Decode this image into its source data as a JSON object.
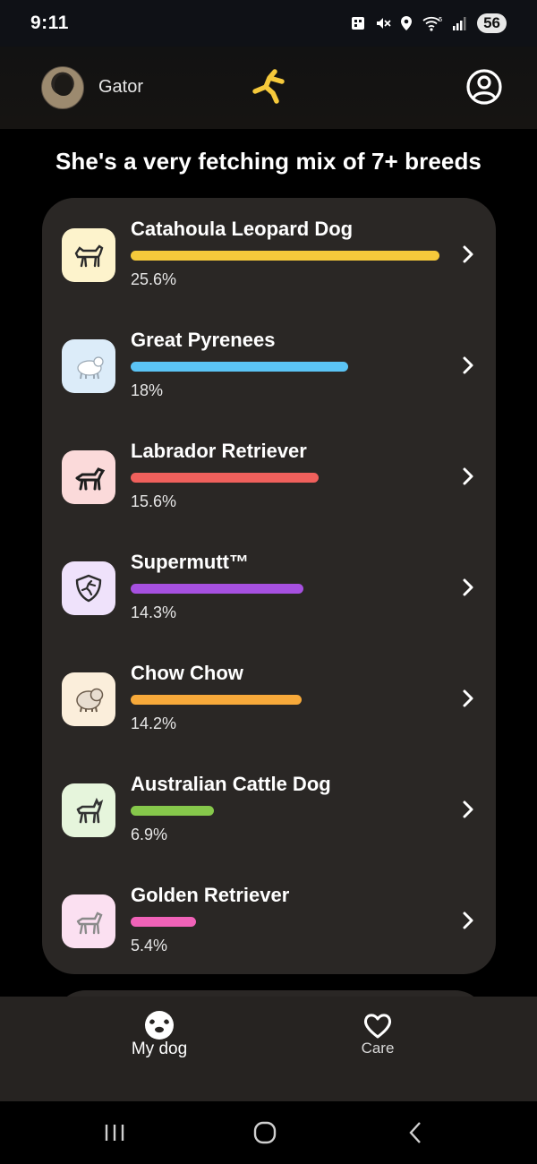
{
  "status_bar": {
    "time": "9:11",
    "battery": "56",
    "network": "5"
  },
  "header": {
    "dog_name": "Gator"
  },
  "headline": "She's a very fetching mix of 7+ breeds",
  "breeds": [
    {
      "name": "Catahoula Leopard Dog",
      "percent_label": "25.6%",
      "percent": 25.6,
      "color": "#f5c93b",
      "icon_bg": "#fdf3cc",
      "icon": "catahoula-dog-icon"
    },
    {
      "name": "Great Pyrenees",
      "percent_label": "18%",
      "percent": 18,
      "color": "#5bc4f5",
      "icon_bg": "#dcecf9",
      "icon": "great-pyrenees-icon"
    },
    {
      "name": "Labrador Retriever",
      "percent_label": "15.6%",
      "percent": 15.6,
      "color": "#f0605c",
      "icon_bg": "#fbdada",
      "icon": "labrador-icon"
    },
    {
      "name": "Supermutt™",
      "percent_label": "14.3%",
      "percent": 14.3,
      "color": "#a650e0",
      "icon_bg": "#efe2fb",
      "icon": "supermutt-shield-icon"
    },
    {
      "name": "Chow Chow",
      "percent_label": "14.2%",
      "percent": 14.2,
      "color": "#f7a93a",
      "icon_bg": "#fbeedb",
      "icon": "chow-chow-icon"
    },
    {
      "name": "Australian Cattle Dog",
      "percent_label": "6.9%",
      "percent": 6.9,
      "color": "#86c84b",
      "icon_bg": "#e6f5dc",
      "icon": "cattle-dog-icon"
    },
    {
      "name": "Golden Retriever",
      "percent_label": "5.4%",
      "percent": 5.4,
      "color": "#f062b8",
      "icon_bg": "#fbe0f1",
      "icon": "golden-retriever-icon"
    }
  ],
  "nav": {
    "my_dog": "My dog",
    "care": "Care"
  },
  "colors": {
    "accent": "#f5c93b",
    "card_bg": "#2a2725",
    "nav_bg": "#262321"
  }
}
